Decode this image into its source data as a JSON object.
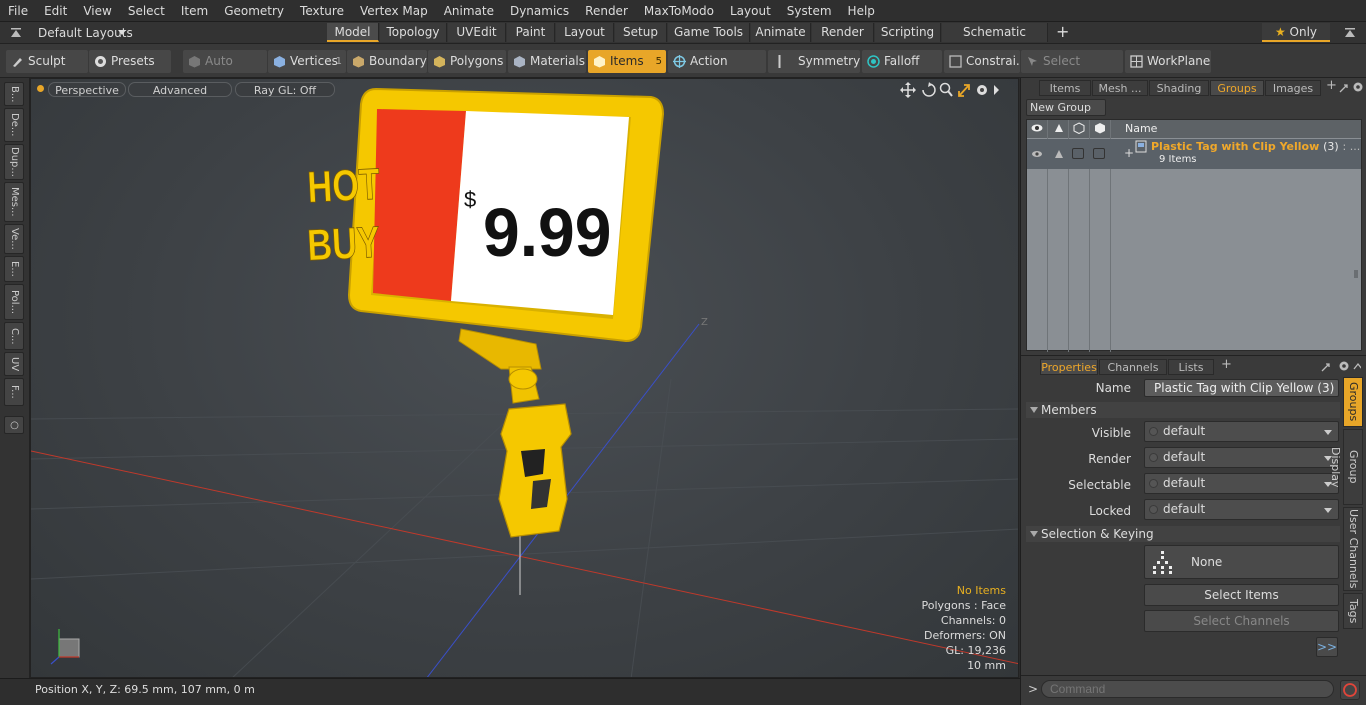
{
  "menu": [
    "File",
    "Edit",
    "View",
    "Select",
    "Item",
    "Geometry",
    "Texture",
    "Vertex Map",
    "Animate",
    "Dynamics",
    "Render",
    "MaxToModo",
    "Layout",
    "System",
    "Help"
  ],
  "layout_selector": "Default Layouts",
  "layout_tabs": [
    "Model",
    "Topology",
    "UVEdit",
    "Paint",
    "Layout",
    "Setup",
    "Game Tools",
    "Animate",
    "Render",
    "Scripting",
    "Schematic Fusion"
  ],
  "add_tab_glyph": "+",
  "only_label": "Only",
  "toolbar": {
    "sculpt": "Sculpt",
    "presets": "Presets",
    "auto_select": "Auto Select",
    "vertices": "Vertices",
    "vertices_count": "1",
    "boundary": "Boundary",
    "polygons": "Polygons",
    "materials": "Materials",
    "items": "Items",
    "items_count": "5",
    "action_center": "Action Center",
    "symmetry": "Symmetry",
    "falloff": "Falloff",
    "constraints": "Constrai...",
    "select_through": "Select Through",
    "workplane": "WorkPlane"
  },
  "left_tabs": [
    "B...",
    "De...",
    "Dup...",
    "Mes...",
    "Ve...",
    "E...",
    "Pol...",
    "C...",
    "UV",
    "F..."
  ],
  "viewport": {
    "perspective": "Perspective",
    "advanced": "Advanced",
    "raygl": "Ray GL: Off",
    "sign": {
      "left_top": "HOT",
      "left_bottom": "BUY",
      "currency": "$",
      "price": "9.99"
    },
    "axis_label": "Z",
    "stats": {
      "no_items": "No Items",
      "polygons": "Polygons : Face",
      "channels": "Channels: 0",
      "deformers": "Deformers: ON",
      "gl": "GL: 19,236",
      "scale": "10 mm"
    },
    "colors": {
      "sign_frame": "#f5c800",
      "sign_red": "#ee3a1c",
      "axis_x": "#c0392b",
      "axis_z": "#3a4fc8"
    }
  },
  "status": "Position X, Y, Z:   69.5 mm, 107 mm, 0 m",
  "right_panel": {
    "top_tabs": [
      "Items",
      "Mesh ...",
      "Shading",
      "Groups",
      "Images"
    ],
    "new_group": "New Group",
    "name_col": "Name",
    "group": {
      "name": "Plastic Tag with Clip Yellow",
      "count": "(3)",
      "ellipsis": ": ...",
      "items": "9 Items"
    },
    "bottom_tabs": [
      "Properties",
      "Channels",
      "Lists"
    ],
    "name_label": "Name",
    "name_value": "Plastic Tag with Clip Yellow (3)",
    "members": "Members",
    "visible_label": "Visible",
    "visible_value": "default",
    "render_label": "Render",
    "render_value": "default",
    "selectable_label": "Selectable",
    "selectable_value": "default",
    "locked_label": "Locked",
    "locked_value": "default",
    "selection_keying": "Selection & Keying",
    "none_label": "None",
    "select_items": "Select Items",
    "select_channels": "Select Channels",
    "more_glyph": ">>",
    "side_tabs": [
      "Groups",
      "Group Display",
      "User Channels",
      "Tags"
    ],
    "command_prompt": ">",
    "command_placeholder": "Command"
  }
}
